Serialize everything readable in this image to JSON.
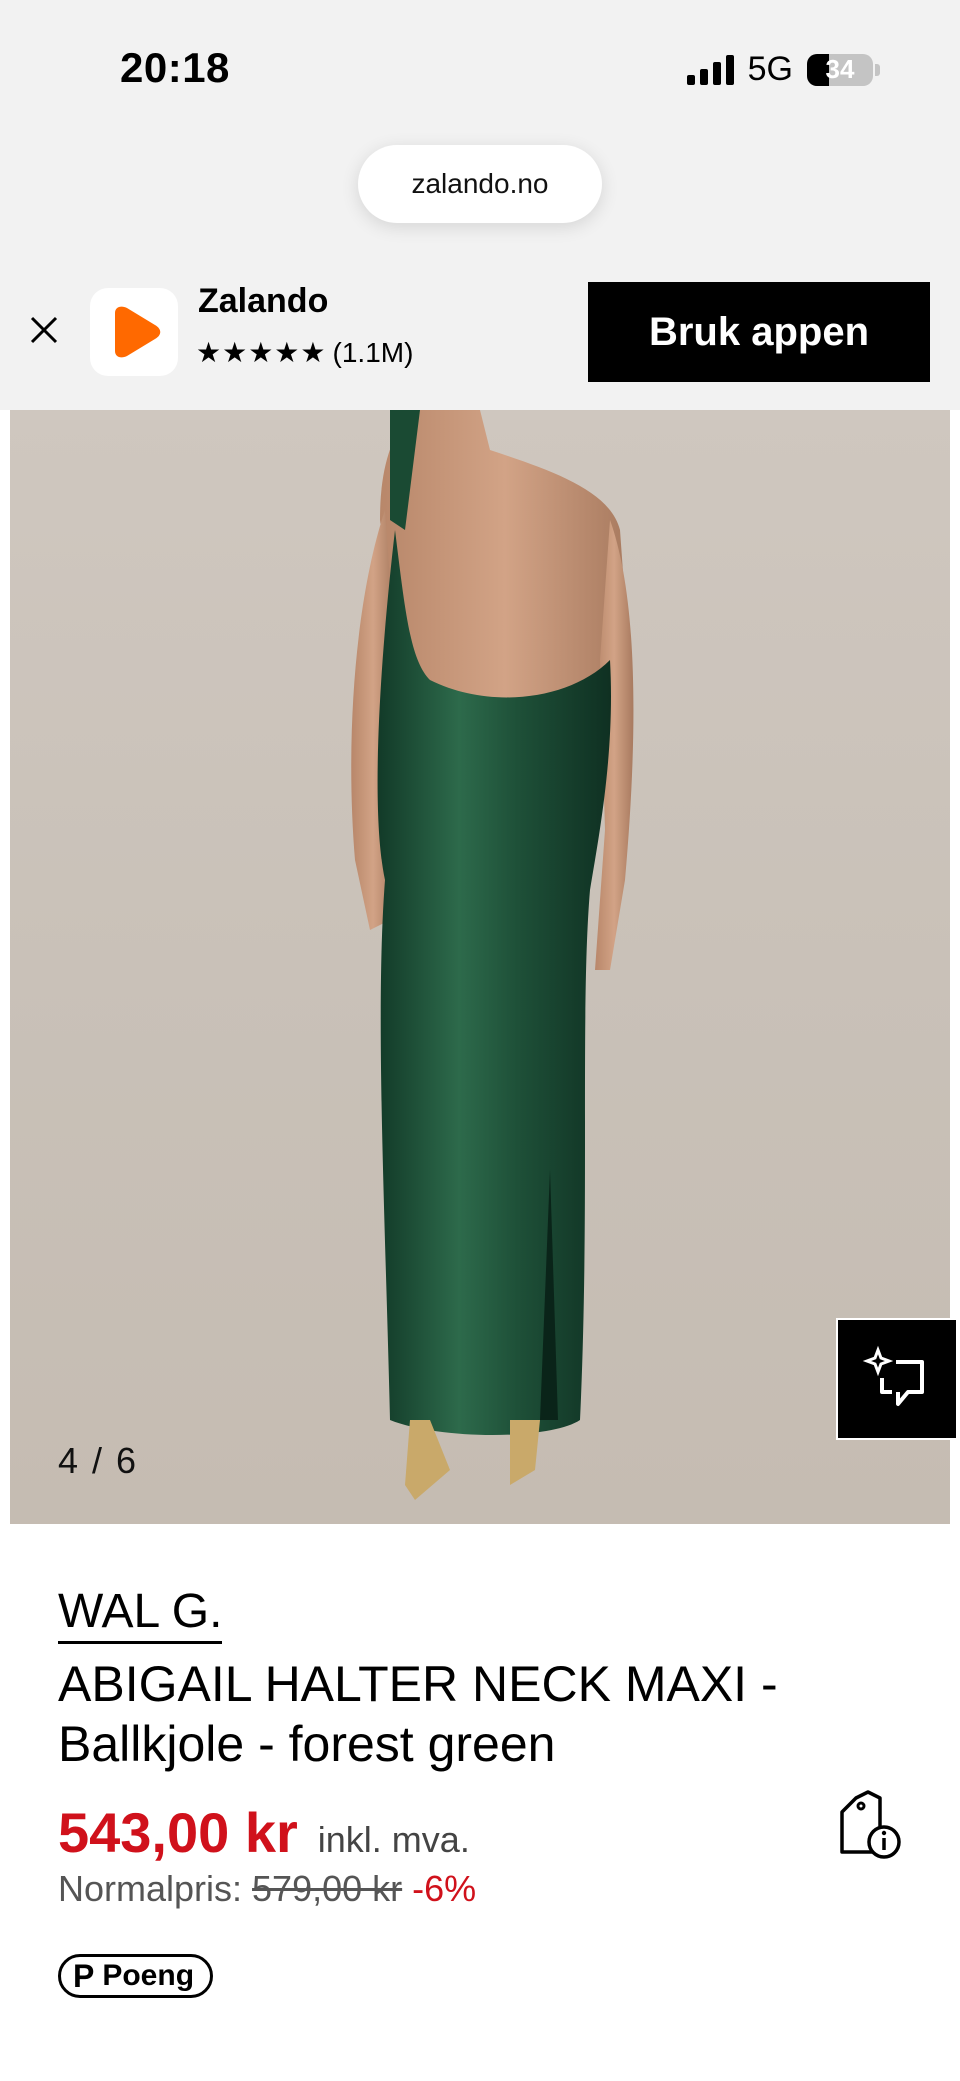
{
  "status_bar": {
    "time": "20:18",
    "network": "5G",
    "battery_level": "34",
    "battery_fraction": 0.34
  },
  "browser": {
    "url": "zalando.no"
  },
  "app_banner": {
    "app_name": "Zalando",
    "stars": "★★★★★",
    "reviews": "(1.1M)",
    "cta_label": "Bruk appen",
    "close_icon": "close-icon",
    "brand_color": "#ff6900"
  },
  "gallery": {
    "counter": "4 / 6",
    "ai_icon": "sparkle-chat-icon"
  },
  "product": {
    "brand": "WAL G.",
    "title_line1": "ABIGAIL HALTER NECK MAXI -",
    "title_line2": "Ballkjole - forest green",
    "price": "543,00 kr",
    "vat_label": "inkl. mva.",
    "normal_label": "Normalpris:",
    "normal_price": "579,00 kr",
    "discount": "-6%",
    "sale_color": "#d0111b",
    "points_icon": "P",
    "points_label": "Poeng",
    "info_icon": "tag-info-icon"
  }
}
